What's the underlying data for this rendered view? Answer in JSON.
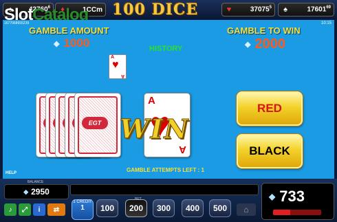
{
  "watermark": {
    "slot": "Slot",
    "catalog": "Catalog"
  },
  "game_title": "100 DICE",
  "jackpots": [
    {
      "icon": "spade",
      "value": "42760",
      "sup": "6"
    },
    {
      "icon": "diamond",
      "value": "1CCm",
      "sup": ""
    },
    {
      "icon": "heart",
      "value": "37075",
      "sup": "5"
    },
    {
      "icon": "spade",
      "value": "17601",
      "sup": "69"
    }
  ],
  "ticket_id": "1677068655239",
  "clock": "10:15",
  "gamble": {
    "amount_label": "GAMBLE AMOUNT",
    "amount_value": "1000",
    "to_win_label": "GAMBLE TO WIN",
    "to_win_value": "2000",
    "history_label": "HISTORY",
    "history_card": {
      "rank": "A",
      "suit": "heart"
    },
    "deck_brand": "EGT",
    "current_card": {
      "rank": "A",
      "suit": "heart"
    },
    "result_text": "WIN",
    "red_button": "RED",
    "black_button": "BLACK",
    "attempts_text": "GAMBLE ATTEMPTS LEFT :",
    "attempts_value": "1",
    "help_label": "HELP"
  },
  "bottom": {
    "balance_label": "BALANCE",
    "balance_value": "2950",
    "win_value": "733",
    "win_progress": 0.35,
    "credit_label": "1 CREDIT",
    "credit_value": "1",
    "bet_label": "BET",
    "bets": [
      "100",
      "200",
      "300",
      "400",
      "500"
    ],
    "selected_bet": "200"
  },
  "colors": {
    "table": "#1a9be3",
    "label": "#f5e03a",
    "amount": "#ff5a1a",
    "red": "#d6141c"
  }
}
